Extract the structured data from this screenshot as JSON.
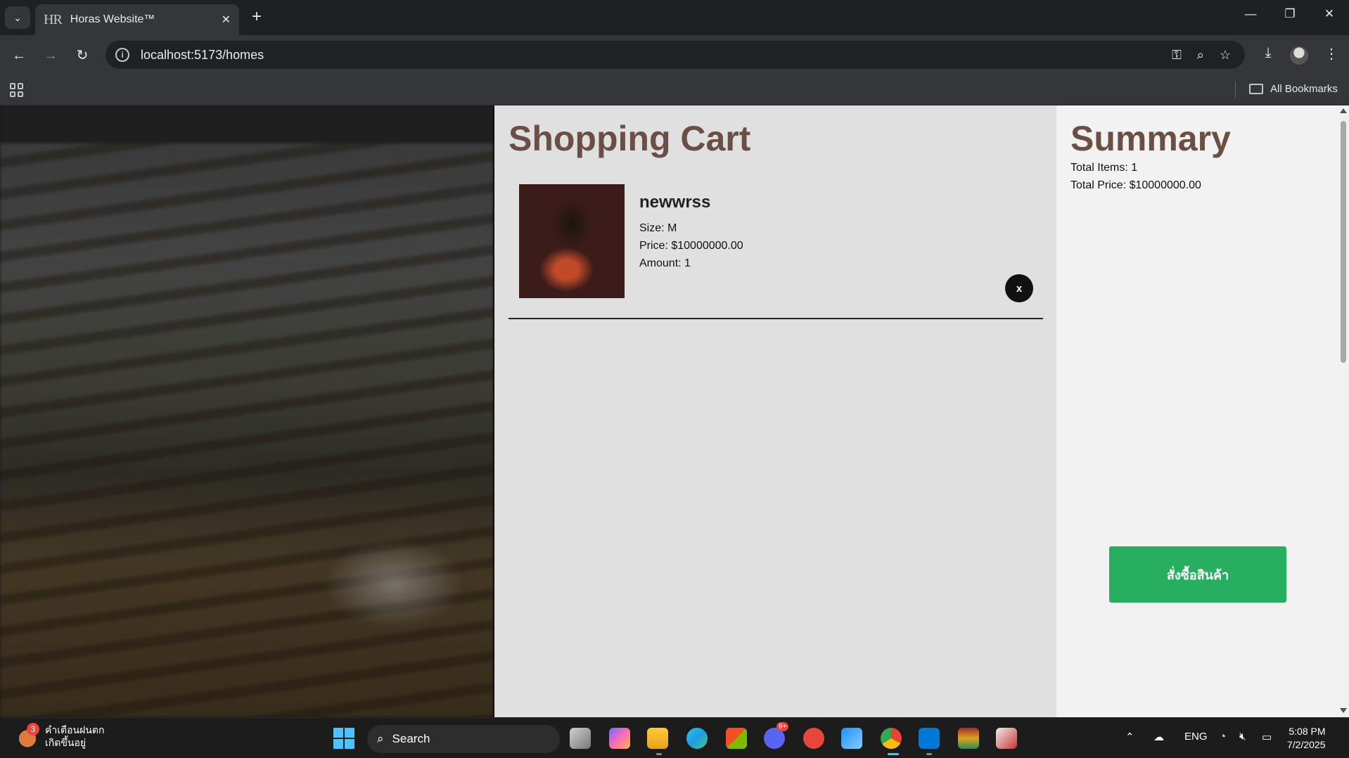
{
  "browser": {
    "tab_title": "Horas Website™",
    "tab_favicon": "HR",
    "tab_close": "✕",
    "new_tab": "+",
    "url": "localhost:5173/homes",
    "bookmarks_label": "All Bookmarks"
  },
  "page": {
    "cart": {
      "title": "Shopping Cart",
      "items": [
        {
          "name": "newwrss",
          "size_line": "Size: M",
          "price_line": "Price: $10000000.00",
          "amount_line": "Amount: 1",
          "remove_label": "x"
        }
      ]
    },
    "summary": {
      "title": "Summary",
      "total_items_line": "Total Items: 1",
      "total_price_line": "Total Price: $10000000.00",
      "checkout_label": "สั่งซื้อสินค้า"
    },
    "colors": {
      "accent_brown": "#6b4f45",
      "checkout_green": "#27ae60"
    }
  },
  "taskbar": {
    "weather_badge": "3",
    "weather_line1": "คำเตือนฝนตก",
    "weather_line2": "เกิดขึ้นอยู่",
    "search_label": "Search",
    "discord_badge": "9+",
    "language": "ENG",
    "time": "5:08 PM",
    "date": "7/2/2025"
  }
}
